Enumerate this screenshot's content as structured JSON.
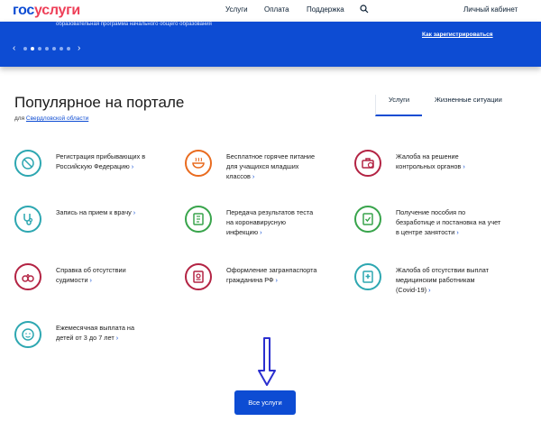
{
  "header": {
    "logo_gos": "гос",
    "logo_usl": "услуги",
    "nav": [
      "Услуги",
      "Оплата",
      "Поддержка"
    ],
    "search_icon": "search-icon",
    "cabinet": "Личный кабинет"
  },
  "banner": {
    "text": "образовательная программа начального общего образования",
    "register_link": "Как зарегистрироваться",
    "prev": "‹",
    "next": "›",
    "dots_count": 7,
    "active_dot": 1
  },
  "section": {
    "title": "Популярное на портале",
    "region_prefix": "для",
    "region_link": "Свердловской области",
    "tabs": [
      "Услуги",
      "Жизненные ситуации"
    ]
  },
  "services": [
    {
      "label": "Регистрация прибывающих в Российскую Федерацию",
      "icon": "passport-stamp-icon",
      "color": "#2da7b1"
    },
    {
      "label": "Бесплатное горячее питание для учащихся младших классов",
      "icon": "food-bowl-icon",
      "color": "#e96b1f"
    },
    {
      "label": "Жалоба на решение контрольных органов",
      "icon": "complaint-briefcase-icon",
      "color": "#b32343"
    },
    {
      "label": "Запись на прием к врачу",
      "icon": "stethoscope-icon",
      "color": "#2da7b1"
    },
    {
      "label": "Передача результатов теста на коронавирусную инфекцию",
      "icon": "test-tube-icon",
      "color": "#38a44b"
    },
    {
      "label": "Получение пособия по безработице и постановка на учет в центре занятости",
      "icon": "document-check-icon",
      "color": "#38a44b"
    },
    {
      "label": "Справка об отсутствии судимости",
      "icon": "handcuffs-icon",
      "color": "#b32343"
    },
    {
      "label": "Оформление загранпаспорта гражданина РФ",
      "icon": "passport-icon",
      "color": "#b32343"
    },
    {
      "label": "Жалоба об отсутствии выплат медицинским работникам (Covid-19)",
      "icon": "medical-document-icon",
      "color": "#2da7b1"
    },
    {
      "label": "Ежемесячная выплата на детей от 3 до 7 лет",
      "icon": "child-face-icon",
      "color": "#2da7b1"
    }
  ],
  "chevron": "›",
  "all_services_button": "Все услуги"
}
